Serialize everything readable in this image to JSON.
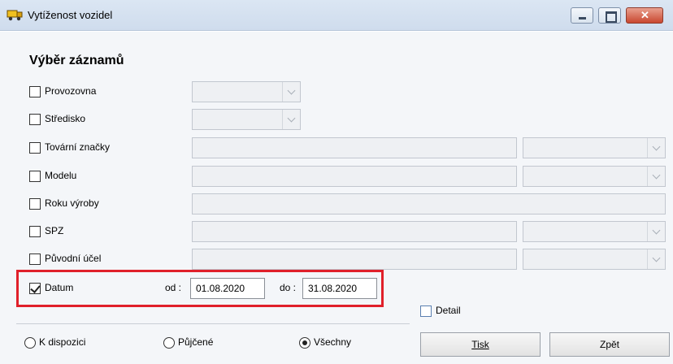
{
  "window": {
    "title": "Vytíženost vozidel",
    "icon": "truck-icon"
  },
  "section_title": "Výběr záznamů",
  "filters": [
    {
      "label": "Provozovna",
      "checked": false,
      "field_type": "combo-short"
    },
    {
      "label": "Středisko",
      "checked": false,
      "field_type": "combo-short"
    },
    {
      "label": "Tovární značky",
      "checked": false,
      "field_type": "text+combo"
    },
    {
      "label": "Modelu",
      "checked": false,
      "field_type": "text+combo"
    },
    {
      "label": "Roku výroby",
      "checked": false,
      "field_type": "text-wide"
    },
    {
      "label": "SPZ",
      "checked": false,
      "field_type": "text+combo"
    },
    {
      "label": "Původní účel",
      "checked": false,
      "field_type": "text+combo"
    }
  ],
  "datum": {
    "label": "Datum",
    "checked": true,
    "od_label": "od :",
    "od_value": "01.08.2020",
    "do_label": "do :",
    "do_value": "31.08.2020"
  },
  "detail": {
    "label": "Detail",
    "checked": false
  },
  "radios": [
    {
      "label": "K dispozici",
      "selected": false
    },
    {
      "label": "Půjčené",
      "selected": false
    },
    {
      "label": "Všechny",
      "selected": true
    }
  ],
  "buttons": {
    "print": "Tisk",
    "back": "Zpět"
  },
  "colors": {
    "highlight": "#e0202a",
    "titlebar": "#dbe6f3",
    "close_button": "#c9472f"
  }
}
